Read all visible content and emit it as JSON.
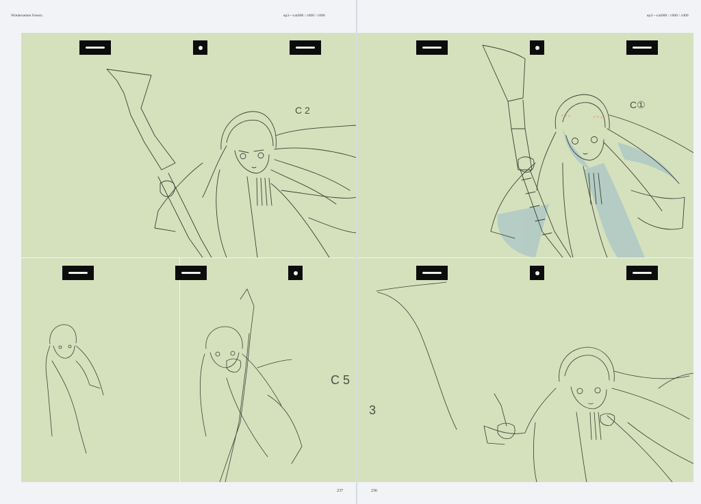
{
  "left_page": {
    "running_head": "Wiedersehen Feiern.",
    "folio": "237",
    "cut_label": "ep3—cut000 / c000 / c000"
  },
  "right_page": {
    "cut_label": "ep3—cut000 / c000 / c000",
    "folio": "236"
  },
  "panels": {
    "top_left": {
      "note": "C 2"
    },
    "top_right": {
      "note": "C①"
    },
    "bottom_left_b": {
      "note": "C 5"
    },
    "bottom_right": {
      "note": "3"
    }
  },
  "colors": {
    "paper": "#d5e1bd",
    "page": "#f1f3f6",
    "ink": "#3a3f35",
    "shadow_tint": "#a9c6c7",
    "blush": "#e6a37d"
  }
}
